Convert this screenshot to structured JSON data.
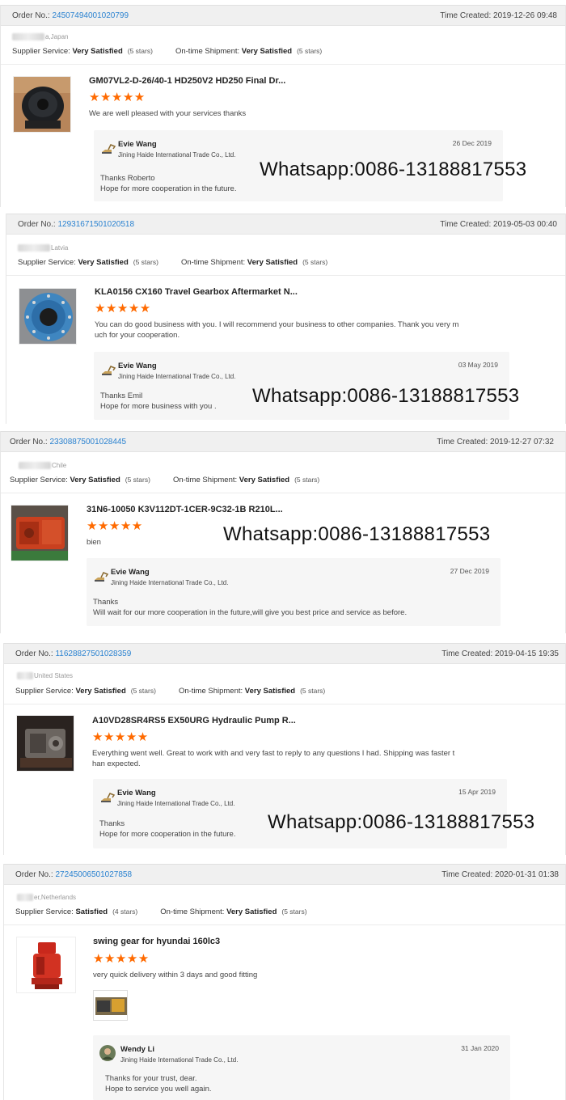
{
  "labels": {
    "order_no": "Order No.:",
    "time_created": "Time Created:",
    "supplier_service": "Supplier Service:",
    "ontime_shipment": "On-time Shipment:"
  },
  "colors": {
    "star": "#ff6a00",
    "link": "#2a82d0",
    "header_bg": "#f0f0f0"
  },
  "orders": [
    {
      "order_no": "24507494001020799",
      "time_created": "2019-12-26 09:48",
      "location": "a,Japan",
      "supplier_rating": "Very Satisfied",
      "supplier_stars": "(5 stars)",
      "shipment_rating": "Very Satisfied",
      "shipment_stars": "(5 stars)",
      "product_title": "GM07VL2-D-26/40-1 HD250V2 HD250 Final Dr...",
      "stars": "★★★★★",
      "review_lines": [
        "We are well pleased with your services thanks"
      ],
      "reply": {
        "name": "Evie Wang",
        "company": "Jining Haide International Trade Co., Ltd.",
        "date": "26 Dec 2019",
        "lines": [
          "Thanks Roberto",
          "Hope for more cooperation in the future."
        ]
      },
      "watermark": "Whatsapp:0086-13188817553"
    },
    {
      "order_no": "12931671501020518",
      "time_created": "2019-05-03 00:40",
      "location": "Latvia",
      "supplier_rating": "Very Satisfied",
      "supplier_stars": "(5 stars)",
      "shipment_rating": "Very Satisfied",
      "shipment_stars": "(5 stars)",
      "product_title": "KLA0156 CX160 Travel Gearbox Aftermarket N...",
      "stars": "★★★★★",
      "review_lines": [
        "You can do good business with you. I will recommend your business to other companies. Thank you very m",
        "uch for your cooperation."
      ],
      "reply": {
        "name": "Evie Wang",
        "company": "Jining Haide International Trade Co., Ltd.",
        "date": "03 May 2019",
        "lines": [
          "Thanks Emil",
          "Hope for more business with you ."
        ]
      },
      "watermark": "Whatsapp:0086-13188817553"
    },
    {
      "order_no": "23308875001028445",
      "time_created": "2019-12-27 07:32",
      "location": "Chile",
      "supplier_rating": "Very Satisfied",
      "supplier_stars": "(5 stars)",
      "shipment_rating": "Very Satisfied",
      "shipment_stars": "(5 stars)",
      "product_title": "31N6-10050 K3V112DT-1CER-9C32-1B R210L...",
      "stars": "★★★★★",
      "review_lines": [
        "bien"
      ],
      "reply": {
        "name": "Evie Wang",
        "company": "Jining Haide International Trade Co., Ltd.",
        "date": "27 Dec 2019",
        "lines": [
          "Thanks",
          "Will wait for our more cooperation in the future,will give you best price and service as before."
        ]
      },
      "watermark": "Whatsapp:0086-13188817553"
    },
    {
      "order_no": "11628827501028359",
      "time_created": "2019-04-15 19:35",
      "location": "United States",
      "supplier_rating": "Very Satisfied",
      "supplier_stars": "(5 stars)",
      "shipment_rating": "Very Satisfied",
      "shipment_stars": "(5 stars)",
      "product_title": "A10VD28SR4RS5 EX50URG Hydraulic Pump R...",
      "stars": "★★★★★",
      "review_lines": [
        "Everything went well. Great to work with and very fast to reply to any questions I had. Shipping was faster t",
        "han expected."
      ],
      "reply": {
        "name": "Evie Wang",
        "company": "Jining Haide International Trade Co., Ltd.",
        "date": "15 Apr 2019",
        "lines": [
          "Thanks",
          "Hope for more cooperation in the future."
        ]
      },
      "watermark": "Whatsapp:0086-13188817553"
    },
    {
      "order_no": "27245006501027858",
      "time_created": "2020-01-31 01:38",
      "location": "er,Netherlands",
      "supplier_rating": "Satisfied",
      "supplier_stars": "(4 stars)",
      "shipment_rating": "Very Satisfied",
      "shipment_stars": "(5 stars)",
      "product_title": "swing gear for hyundai 160lc3",
      "stars": "★★★★★",
      "review_lines": [
        "very quick delivery within 3 days and good fitting"
      ],
      "reply": {
        "name": "Wendy Li",
        "company": "Jining Haide International Trade Co., Ltd.",
        "date": "31 Jan 2020",
        "lines": [
          "Thanks for your trust, dear.",
          "Hope to service you well again."
        ]
      }
    }
  ]
}
